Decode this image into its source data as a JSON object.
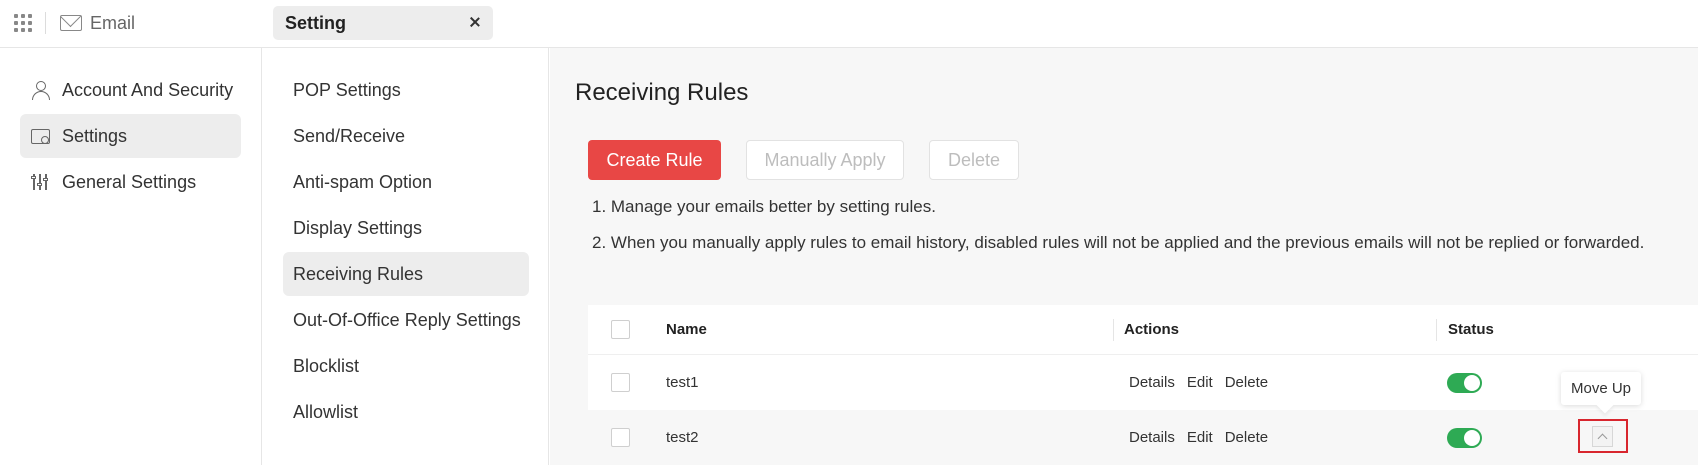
{
  "topbar": {
    "apps_icon": "apps-grid-icon",
    "email_tab_label": "Email",
    "setting_tab_label": "Setting"
  },
  "leftnav": {
    "items": [
      {
        "label": "Account And Security",
        "icon": "user-icon",
        "active": false
      },
      {
        "label": "Settings",
        "icon": "mail-settings-icon",
        "active": true
      },
      {
        "label": "General Settings",
        "icon": "sliders-icon",
        "active": false
      }
    ]
  },
  "midnav": {
    "items": [
      {
        "label": "POP Settings"
      },
      {
        "label": "Send/Receive"
      },
      {
        "label": "Anti-spam Option"
      },
      {
        "label": "Display Settings"
      },
      {
        "label": "Receiving Rules",
        "active": true
      },
      {
        "label": "Out-Of-Office Reply Settings"
      },
      {
        "label": "Blocklist"
      },
      {
        "label": "Allowlist"
      }
    ]
  },
  "main": {
    "title": "Receiving Rules",
    "buttons": {
      "create": "Create Rule",
      "apply": "Manually Apply",
      "delete": "Delete"
    },
    "info": [
      "1. Manage your emails better by setting rules.",
      "2. When you manually apply rules to email history, disabled rules will not be applied and the previous emails will not be replied or forwarded."
    ],
    "table": {
      "headers": {
        "name": "Name",
        "actions": "Actions",
        "status": "Status"
      },
      "rows": [
        {
          "name": "test1",
          "actions": [
            "Details",
            "Edit",
            "Delete"
          ],
          "enabled": true
        },
        {
          "name": "test2",
          "actions": [
            "Details",
            "Edit",
            "Delete"
          ],
          "enabled": true
        }
      ]
    },
    "tooltip": "Move Up"
  },
  "colors": {
    "primary": "#e84745",
    "toggle_on": "#2eaa54",
    "highlight": "#d8262e"
  }
}
